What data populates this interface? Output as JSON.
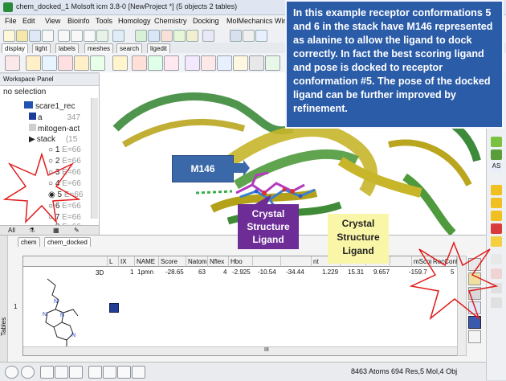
{
  "window": {
    "title": "chem_docked_1 Molsoft icm 3.8-0  [NewProject *] (5 objects 2 tables)"
  },
  "menu": {
    "items": [
      "File",
      "Edit",
      "View",
      "Bioinfo",
      "Tools",
      "Homology",
      "Chemistry",
      "Docking",
      "MolMechanics",
      "Win"
    ]
  },
  "toolbar_tabs": [
    "display",
    "light",
    "labels",
    "meshes",
    "search",
    "ligedit"
  ],
  "workspace": {
    "title": "Workspace Panel",
    "selection": "no selection",
    "tree": [
      {
        "label": "scare1_rec",
        "extra": ""
      },
      {
        "label": "a",
        "extra": "347"
      },
      {
        "label": "mitogen-act",
        "extra": ""
      },
      {
        "label": "stack",
        "extra": "(15"
      }
    ],
    "stack_items": [
      {
        "num": "1",
        "energy": "E=66"
      },
      {
        "num": "2",
        "energy": "E=66"
      },
      {
        "num": "3",
        "energy": "E=66"
      },
      {
        "num": "4",
        "energy": "E=66"
      },
      {
        "num": "5",
        "energy": "E=66"
      },
      {
        "num": "6",
        "energy": "E=66"
      },
      {
        "num": "7",
        "energy": "E=66"
      },
      {
        "num": "8",
        "energy": "E=66"
      }
    ],
    "bottom_tab": "All"
  },
  "tables": {
    "side_label": "Tables",
    "tabs": [
      "chem",
      "chem_docked"
    ],
    "columns": [
      "L",
      "IX",
      "NAME",
      "Score",
      "Natom",
      "Nflex",
      "Hbo",
      "",
      "",
      "nt",
      "Eint",
      "",
      "",
      "mScore",
      "RecConf"
    ],
    "row": {
      "index": "1",
      "ix": "1",
      "name": "1pmn",
      "score": "-28.65",
      "natom": "63",
      "nflex": "4",
      "hbond": "-2.925",
      "c1": "-10.54",
      "c2": "-34.44",
      "eint": "1.229",
      "c3": "15.31",
      "c4": "9.657",
      "mscore": "-159.7",
      "recconf": "5"
    },
    "structure_tag": "3D",
    "scroll_marker": "III"
  },
  "status": {
    "text": "8463 Atoms 694 Res,5 Mol,4 Obj"
  },
  "callouts": {
    "info": "In this example receptor conformations 5 and 6 in the stack have M146 represented as alanine to allow the ligand to dock correctly. In fact the best scoring ligand and pose is docked to receptor conformation #5. The pose of the docked ligand can be further improved by refinement.",
    "m146": "M146",
    "crystal_purple": "Crystal Structure Ligand",
    "crystal_yellow": "Crystal Structure Ligand"
  },
  "colors": {
    "info_box": "#2b5ca8",
    "m146_box": "#3b68a8",
    "crystal_purple": "#6d2c96",
    "crystal_yellow": "#faf6a8",
    "star_outline": "#e01b1b"
  }
}
